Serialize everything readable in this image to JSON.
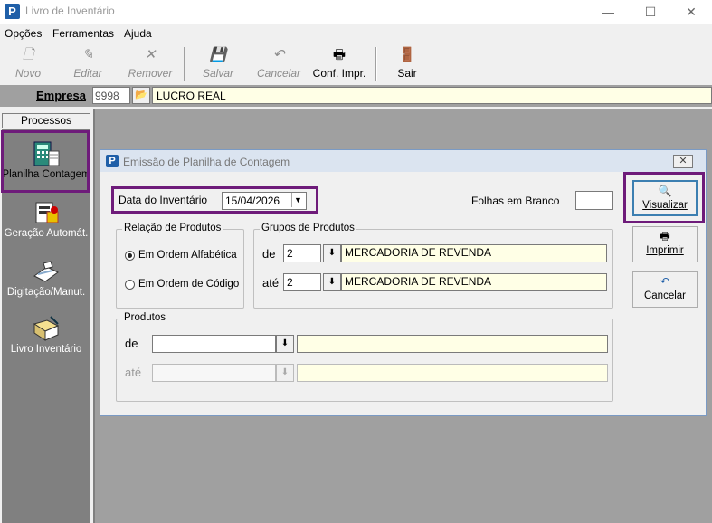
{
  "window": {
    "app_icon": "P",
    "title": "Livro de Inventário",
    "minimize_glyph": "—",
    "maximize_glyph": "☐",
    "close_glyph": "✕"
  },
  "menu": [
    "Opções",
    "Ferramentas",
    "Ajuda"
  ],
  "toolbar": {
    "novo": "Novo",
    "editar": "Editar",
    "remover": "Remover",
    "salvar": "Salvar",
    "cancelar": "Cancelar",
    "conf_impr": "Conf. Impr.",
    "sair": "Sair"
  },
  "empresa": {
    "label": "Empresa",
    "code": "9998",
    "name": "LUCRO REAL"
  },
  "sidebar": {
    "header": "Processos",
    "items": [
      {
        "label": "Planilha Contagem"
      },
      {
        "label": "Geração Automát."
      },
      {
        "label": "Digitação/Manut."
      },
      {
        "label": "Livro Inventário"
      }
    ]
  },
  "dialog": {
    "title": "Emissão de Planilha de Contagem",
    "close_glyph": "✕",
    "data_label": "Data do Inventário",
    "data_value": "15/04/2026",
    "folhas_label": "Folhas em Branco",
    "folhas_value": "",
    "relacao": {
      "title": "Relação de Produtos",
      "opt1": "Em Ordem Alfabética",
      "opt2": "Em Ordem de Código",
      "selected": "Em Ordem Alfabética"
    },
    "grupos": {
      "title": "Grupos de Produtos",
      "de_label": "de",
      "de_code": "2",
      "de_name": "MERCADORIA DE REVENDA",
      "ate_label": "até",
      "ate_code": "2",
      "ate_name": "MERCADORIA DE REVENDA"
    },
    "produtos": {
      "title": "Produtos",
      "de_label": "de",
      "de_code": "",
      "de_name": "",
      "ate_label": "até",
      "ate_code": "",
      "ate_name": ""
    },
    "buttons": {
      "visualizar": "Visualizar",
      "imprimir": "Imprimir",
      "cancelar": "Cancelar"
    }
  },
  "colors": {
    "highlight": "#6e1b7a",
    "yellow_field": "#ffffe6",
    "mdi_background": "#a0a0a0"
  }
}
